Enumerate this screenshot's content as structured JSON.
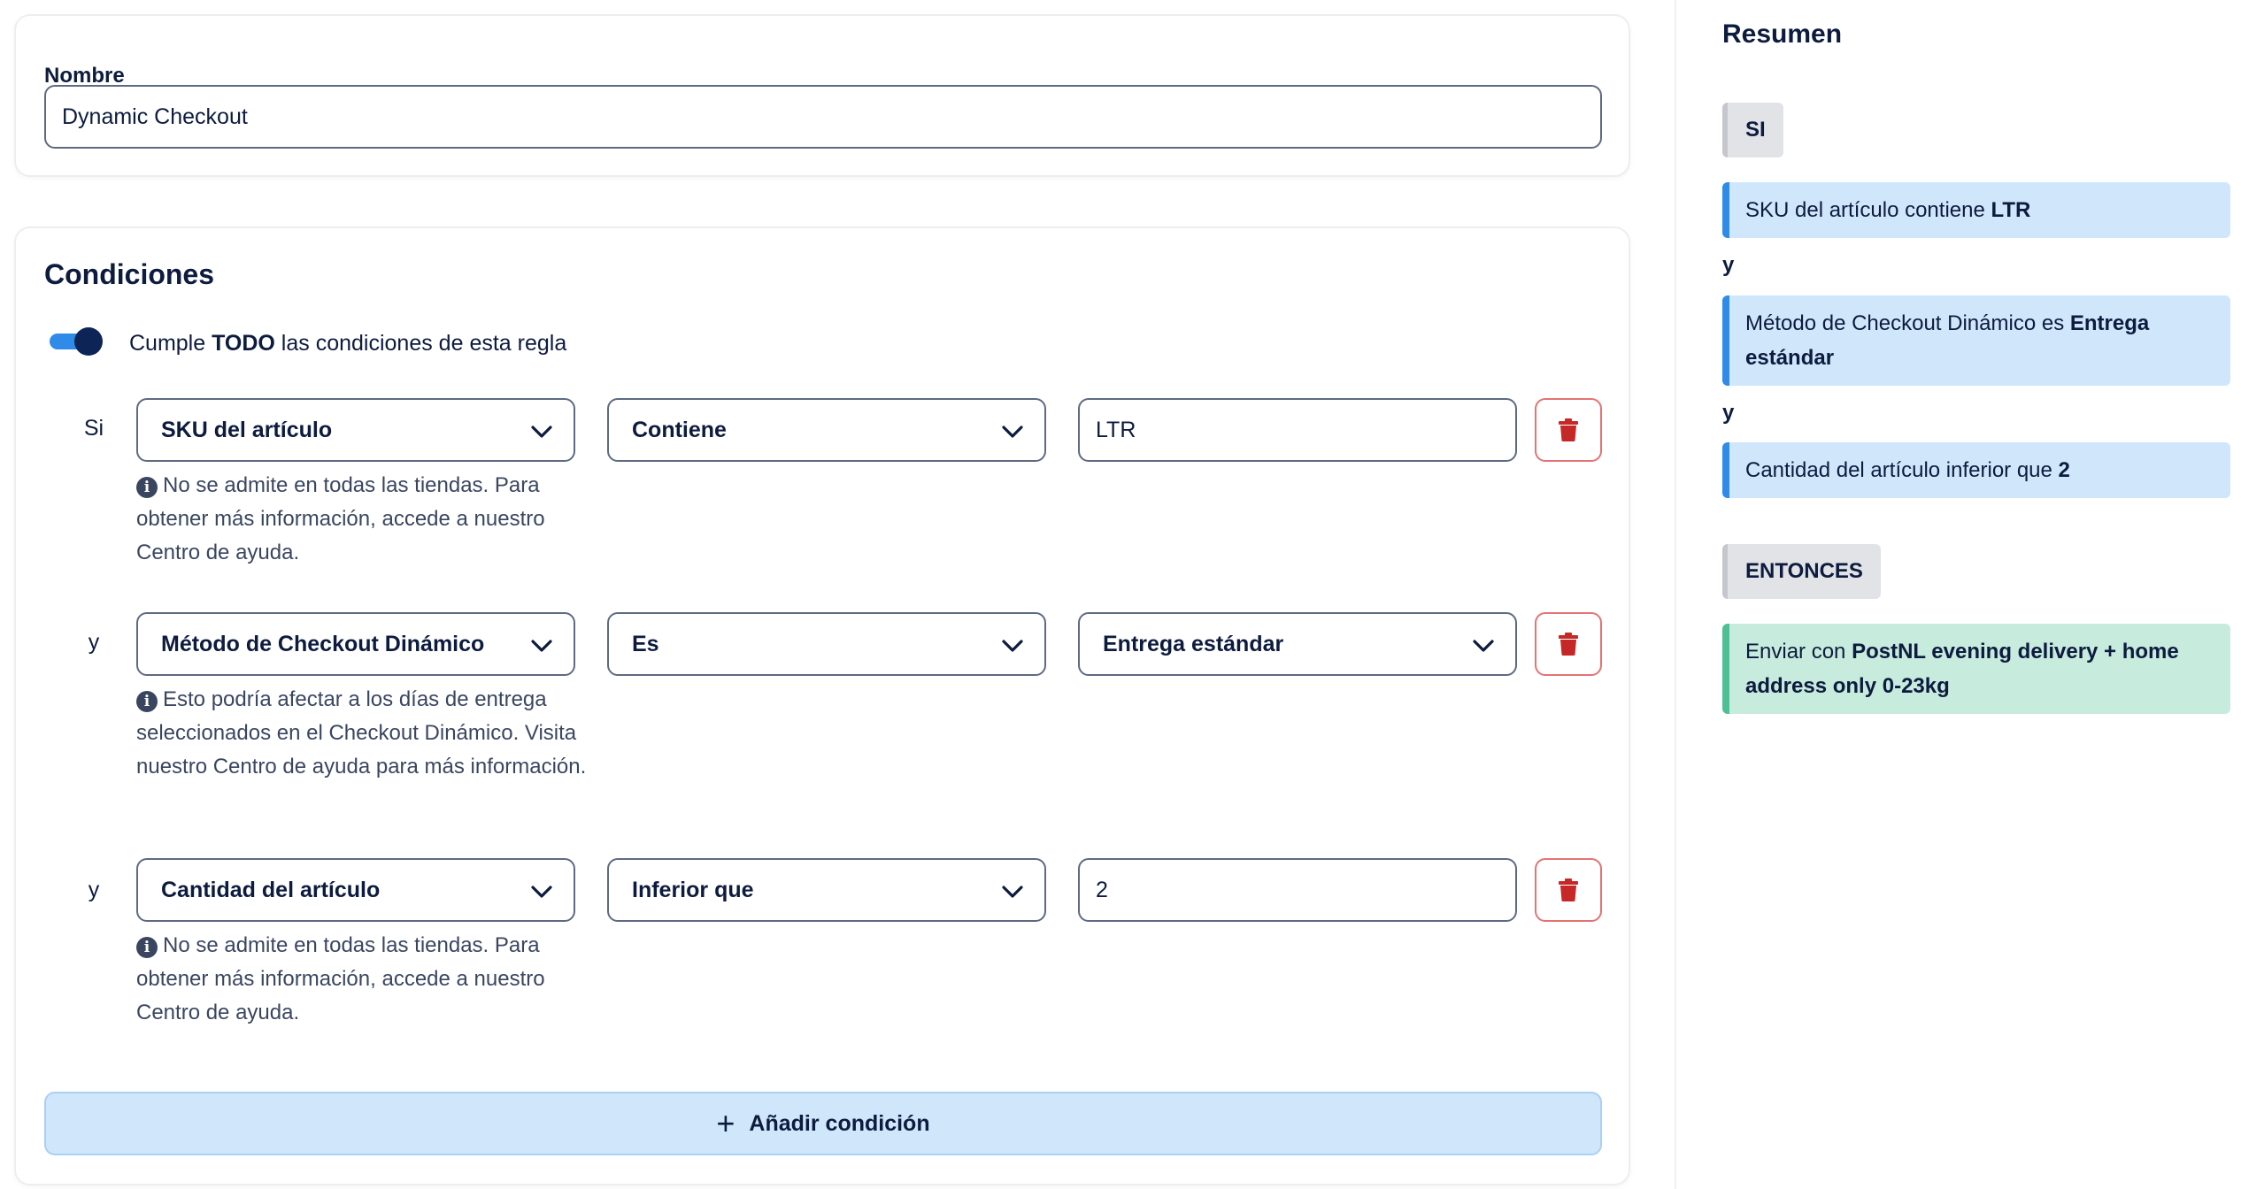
{
  "name_section": {
    "label": "Nombre",
    "value": "Dynamic Checkout"
  },
  "conditions_section": {
    "title": "Condiciones",
    "toggle_on": true,
    "toggle_text_pre": "Cumple ",
    "toggle_text_bold": "TODO",
    "toggle_text_post": " las condiciones de esta regla",
    "rows": [
      {
        "prefix": "Si",
        "field": "SKU del artículo",
        "operator": "Contiene",
        "value": "LTR",
        "note": "No se admite en todas las tiendas. Para obtener más información, accede a nuestro Centro de ayuda."
      },
      {
        "prefix": "y",
        "field": "Método de Checkout Dinámico",
        "operator": "Es",
        "value": "Entrega estándar",
        "note": "Esto podría afectar a los días de entrega seleccionados en el Checkout Dinámico. Visita nuestro Centro de ayuda para más información."
      },
      {
        "prefix": "y",
        "field": "Cantidad del artículo",
        "operator": "Inferior que",
        "value": "2",
        "note": "No se admite en todas las tiendas. Para obtener más información, accede a nuestro Centro de ayuda."
      }
    ],
    "add_button": "Añadir condición"
  },
  "summary": {
    "title": "Resumen",
    "if_tag": "SI",
    "conditions": [
      {
        "text": "SKU del artículo contiene ",
        "bold": "LTR"
      },
      {
        "text": "Método de Checkout Dinámico es ",
        "bold": "Entrega estándar"
      },
      {
        "text": "Cantidad del artículo inferior que ",
        "bold": "2"
      }
    ],
    "joiner": "y",
    "then_tag": "ENTONCES",
    "action": {
      "text": "Enviar con ",
      "bold": "PostNL evening delivery + home address only 0-23kg"
    }
  },
  "colors": {
    "primary_text": "#0d1b3e",
    "accent_blue": "#2f8ae8",
    "summary_blue_bg": "#cfe6fb",
    "summary_green_bg": "#c7ebdd",
    "delete_red": "#c62828"
  },
  "icons": {
    "dropdown": "chevron-down-icon",
    "delete": "trash-icon",
    "info": "info-icon",
    "add": "plus-icon"
  }
}
